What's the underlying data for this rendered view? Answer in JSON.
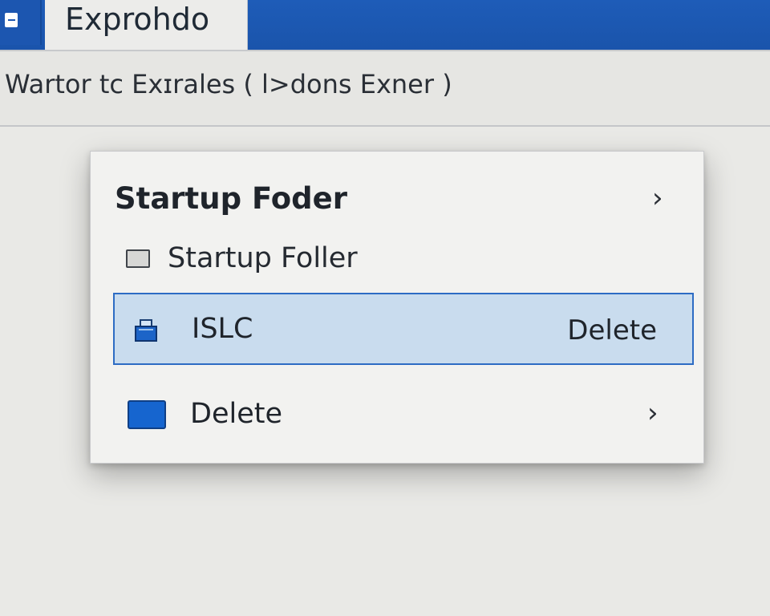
{
  "window": {
    "tab_title": "Exprohdo",
    "app_button_icon": "app-menu-icon"
  },
  "address_bar": {
    "path_text": "Wartor tc Exɪrales ( l>dons Exner )"
  },
  "context_menu": {
    "header": {
      "label": "Startup Foder",
      "icon": "chevron-right-icon"
    },
    "items": [
      {
        "label": "Startup Foller",
        "icon": "folder-icon"
      },
      {
        "label": "ISLC",
        "shortcut": "Delete",
        "icon": "app-icon",
        "selected": true
      },
      {
        "label": "Delete",
        "icon": "blue-square-icon",
        "submenu_icon": "chevron-right-icon"
      }
    ]
  },
  "colors": {
    "titlebar_blue": "#1e5cb8",
    "selection_bg": "#c9dcee",
    "selection_border": "#2d6cc4",
    "swatch_blue": "#1665cf"
  }
}
